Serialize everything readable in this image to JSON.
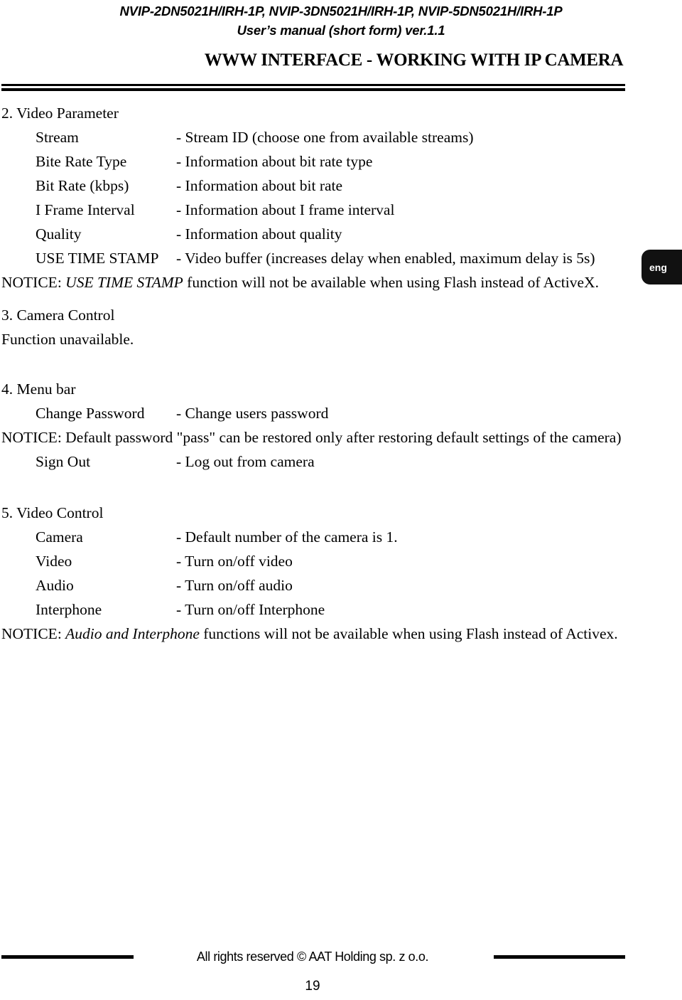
{
  "header": {
    "model_line": "NVIP-2DN5021H/IRH-1P, NVIP-3DN5021H/IRH-1P, NVIP-5DN5021H/IRH-1P",
    "manual_line": "User’s manual (short form) ver.1.1",
    "section_title": "WWW INTERFACE - WORKING WITH IP CAMERA"
  },
  "language_tab": {
    "label": "eng"
  },
  "sections": {
    "video_parameter": {
      "heading": "2.  Video Parameter",
      "rows": [
        {
          "term": "Stream",
          "desc": "- Stream ID (choose one from available streams)"
        },
        {
          "term": "Bite Rate Type",
          "desc": "- Information about bit rate type"
        },
        {
          "term": "Bit Rate (kbps)",
          "desc": "- Information about bit rate"
        },
        {
          "term": "I Frame Interval",
          "desc": "- Information about I frame interval"
        },
        {
          "term": "Quality",
          "desc": "- Information about quality"
        },
        {
          "term": "USE TIME STAMP",
          "desc": "- Video buffer (increases delay when enabled, maximum delay is 5s)"
        }
      ],
      "notice_prefix": "NOTICE: ",
      "notice_italic": "USE TIME STAMP",
      "notice_suffix": " function will not be available when using Flash instead of ActiveX."
    },
    "camera_control": {
      "heading": "3.  Camera Control",
      "body": "Function unavailable."
    },
    "menu_bar": {
      "heading": "4.  Menu bar",
      "rows_before_notice": [
        {
          "term": "Change Password",
          "desc": "- Change users password"
        }
      ],
      "notice": "NOTICE: Default password \"pass\" can be restored only after restoring default settings of the camera)",
      "rows_after_notice": [
        {
          "term": "Sign Out",
          "desc": "- Log out from camera"
        }
      ]
    },
    "video_control": {
      "heading": "5.  Video Control",
      "rows": [
        {
          "term": "Camera",
          "desc": "- Default number of the camera is 1."
        },
        {
          "term": "Video",
          "desc": "- Turn on/off video"
        },
        {
          "term": "Audio",
          "desc": "- Turn on/off audio"
        },
        {
          "term": "Interphone",
          "desc": "- Turn on/off Interphone"
        }
      ],
      "notice_prefix": "NOTICE: ",
      "notice_italic": "Audio and Interphone",
      "notice_suffix": " functions will not be available when using Flash instead of Activex."
    }
  },
  "footer": {
    "copyright": "All rights reserved © AAT Holding sp. z o.o.",
    "page_number": "19"
  }
}
